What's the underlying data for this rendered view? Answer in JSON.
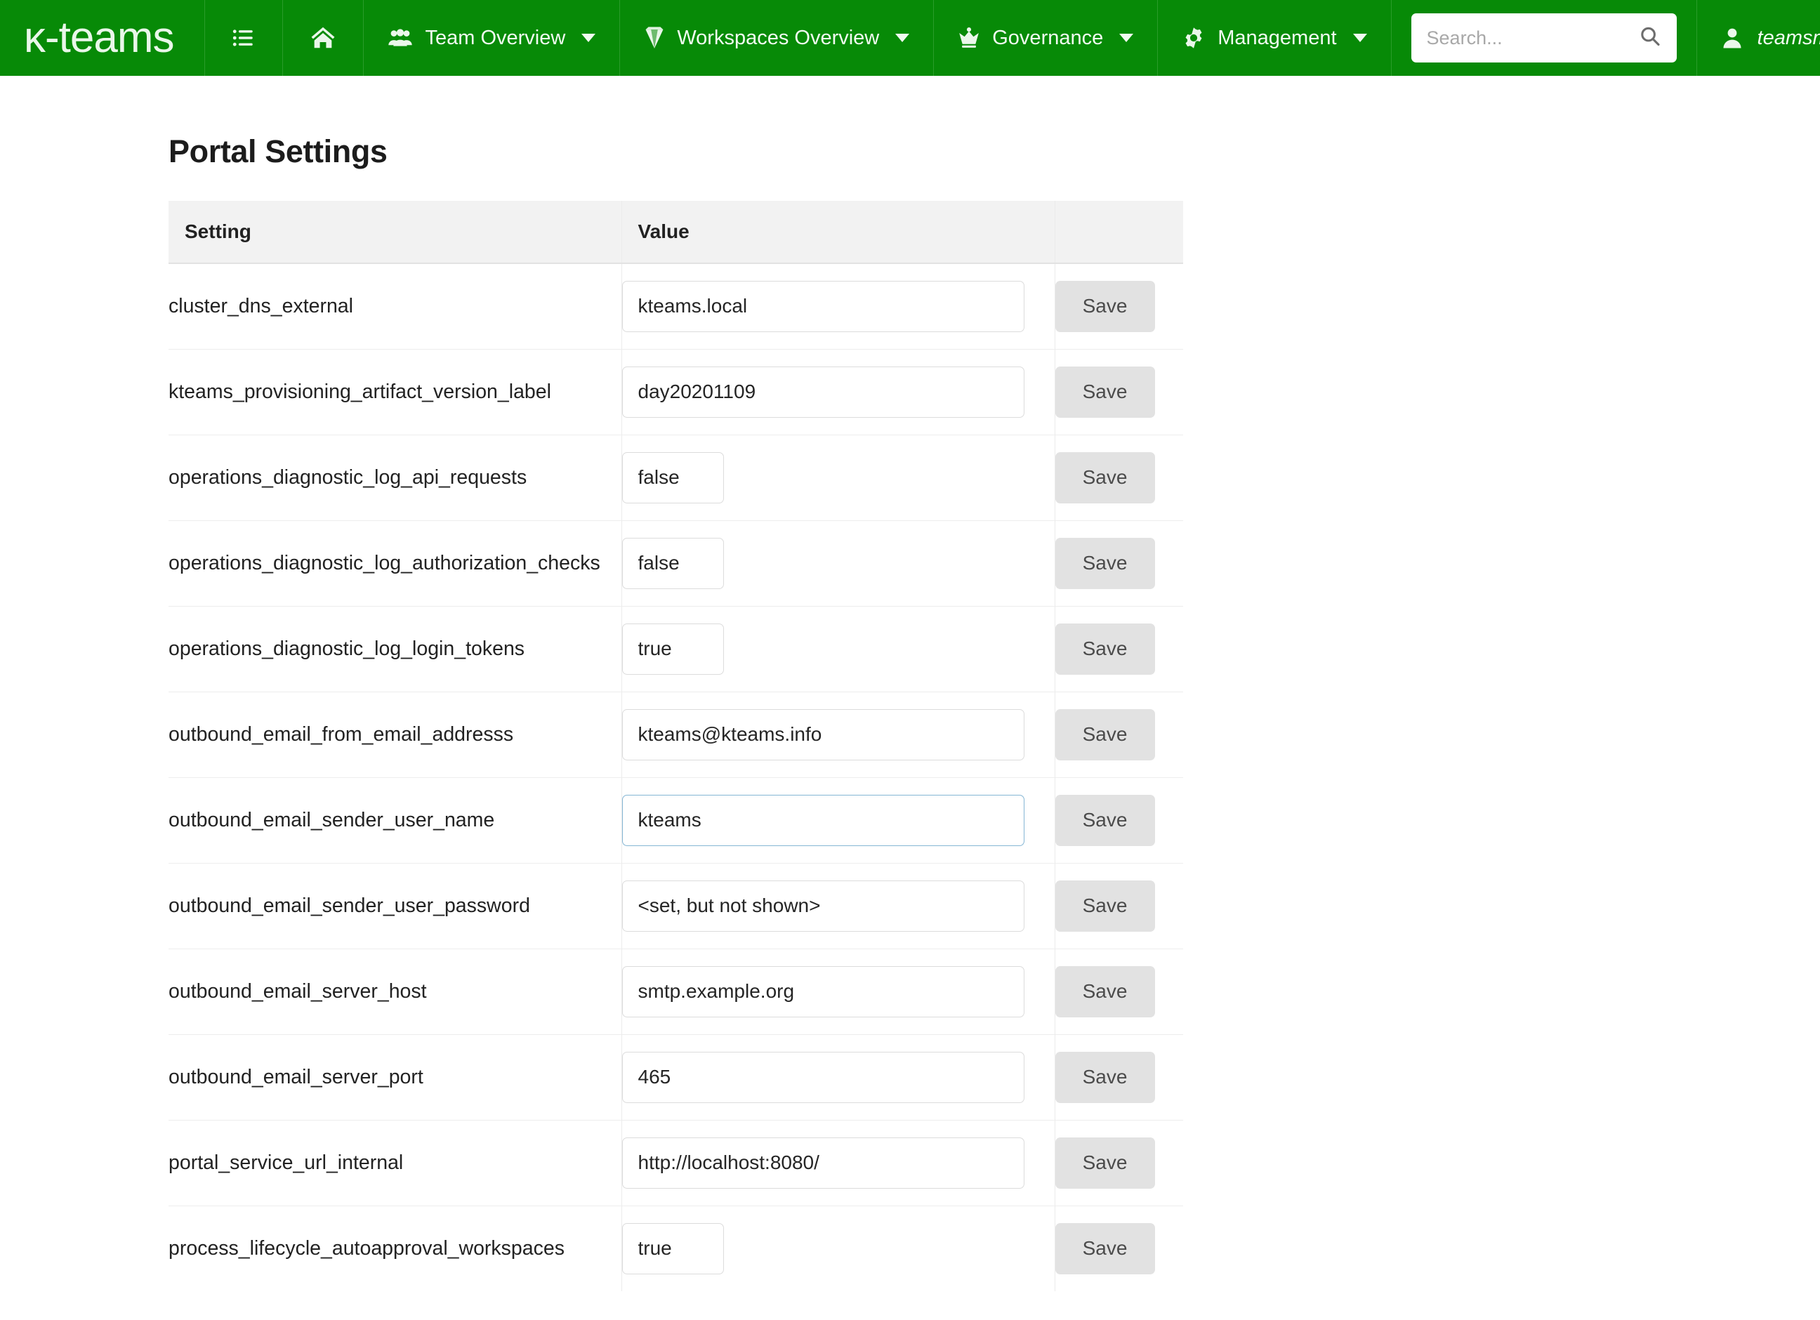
{
  "navbar": {
    "brand": "κ-teams",
    "items": [
      {
        "id": "menu",
        "icon": "list-icon",
        "label": "",
        "caret": false
      },
      {
        "id": "home",
        "icon": "home-icon",
        "label": "",
        "caret": false
      },
      {
        "id": "team",
        "icon": "people-icon",
        "label": "Team Overview",
        "caret": true
      },
      {
        "id": "workspaces",
        "icon": "diamond-icon",
        "label": "Workspaces Overview",
        "caret": true
      },
      {
        "id": "governance",
        "icon": "crown-icon",
        "label": "Governance",
        "caret": true
      },
      {
        "id": "management",
        "icon": "gear-icon",
        "label": "Management",
        "caret": true
      }
    ],
    "search": {
      "placeholder": "Search...",
      "value": "",
      "icon": "search-icon"
    },
    "user": {
      "name": "teamsmar",
      "icon": "user-icon"
    },
    "accent_color": "#078a07",
    "divider_color": "#2a9c2a",
    "text_color": "#f2fbf2"
  },
  "page": {
    "title": "Portal Settings"
  },
  "table": {
    "columns": [
      "Setting",
      "Value",
      ""
    ],
    "save_label": "Save",
    "rows": [
      {
        "setting": "cluster_dns_external",
        "value": "kteams.local",
        "narrow": false,
        "focused": false
      },
      {
        "setting": "kteams_provisioning_artifact_version_label",
        "value": "day20201109",
        "narrow": false,
        "focused": false
      },
      {
        "setting": "operations_diagnostic_log_api_requests",
        "value": "false",
        "narrow": true,
        "focused": false
      },
      {
        "setting": "operations_diagnostic_log_authorization_checks",
        "value": "false",
        "narrow": true,
        "focused": false
      },
      {
        "setting": "operations_diagnostic_log_login_tokens",
        "value": "true",
        "narrow": true,
        "focused": false
      },
      {
        "setting": "outbound_email_from_email_addresss",
        "value": "kteams@kteams.info",
        "narrow": false,
        "focused": false
      },
      {
        "setting": "outbound_email_sender_user_name",
        "value": "kteams",
        "narrow": false,
        "focused": true
      },
      {
        "setting": "outbound_email_sender_user_password",
        "value": "<set, but not shown>",
        "narrow": false,
        "focused": false
      },
      {
        "setting": "outbound_email_server_host",
        "value": "smtp.example.org",
        "narrow": false,
        "focused": false
      },
      {
        "setting": "outbound_email_server_port",
        "value": "465",
        "narrow": false,
        "focused": false
      },
      {
        "setting": "portal_service_url_internal",
        "value": "http://localhost:8080/",
        "narrow": false,
        "focused": false
      },
      {
        "setting": "process_lifecycle_autoapproval_workspaces",
        "value": "true",
        "narrow": true,
        "focused": false
      }
    ]
  }
}
